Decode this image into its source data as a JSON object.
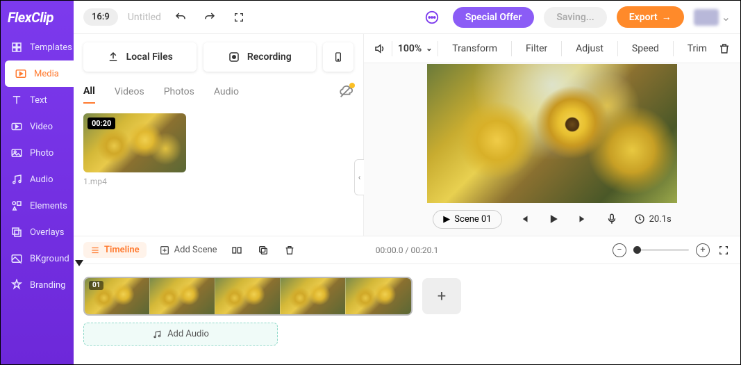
{
  "logo": "FlexClip",
  "topbar": {
    "ratio": "16:9",
    "title": "Untitled",
    "special": "Special Offer",
    "saving": "Saving...",
    "export": "Export"
  },
  "sidebar": {
    "items": [
      {
        "label": "Templates"
      },
      {
        "label": "Media"
      },
      {
        "label": "Text"
      },
      {
        "label": "Video"
      },
      {
        "label": "Photo"
      },
      {
        "label": "Audio"
      },
      {
        "label": "Elements"
      },
      {
        "label": "Overlays"
      },
      {
        "label": "BKground"
      },
      {
        "label": "Branding"
      }
    ]
  },
  "media": {
    "local": "Local Files",
    "recording": "Recording",
    "tabs": {
      "all": "All",
      "videos": "Videos",
      "photos": "Photos",
      "audio": "Audio"
    },
    "clip": {
      "duration": "00:20",
      "name": "1.mp4"
    }
  },
  "toolbar": {
    "zoom": "100%",
    "transform": "Transform",
    "filter": "Filter",
    "adjust": "Adjust",
    "speed": "Speed",
    "trim": "Trim"
  },
  "controls": {
    "scene": "Scene 01",
    "duration": "20.1s"
  },
  "tlbar": {
    "timeline": "Timeline",
    "addscene": "Add Scene",
    "time": "00:00.0 / 00:20.1"
  },
  "timeline": {
    "scene_num": "01",
    "add_audio": "Add Audio"
  }
}
